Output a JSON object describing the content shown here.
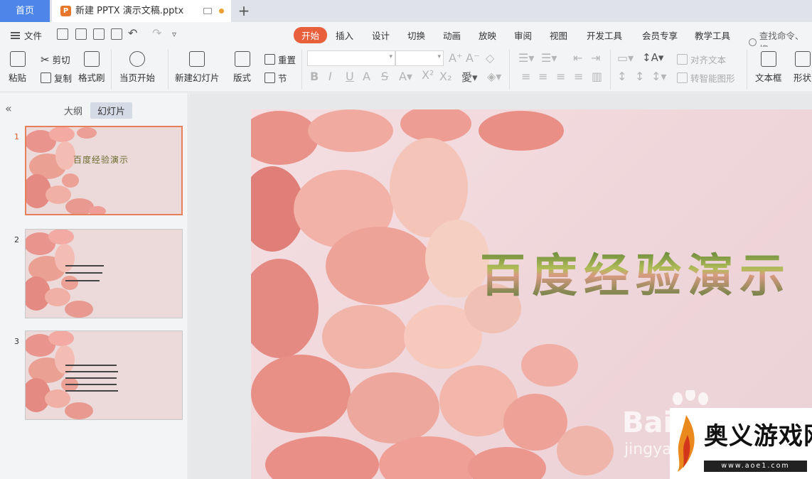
{
  "tabs": {
    "home": "首页",
    "doc_badge": "P",
    "doc_title": "新建 PPTX 演示文稿.pptx",
    "add": "+"
  },
  "menu": {
    "file": "文件",
    "tabs": [
      "开始",
      "插入",
      "设计",
      "切换",
      "动画",
      "放映",
      "审阅",
      "视图",
      "开发工具",
      "会员专享",
      "教学工具"
    ],
    "search": "查找命令、搜"
  },
  "ribbon": {
    "paste": "粘贴",
    "cut": "剪切",
    "copy": "复制",
    "format_painter": "格式刷",
    "play_from_current": "当页开始",
    "new_slide": "新建幻灯片",
    "layout": "版式",
    "reset": "重置",
    "section": "节",
    "align_text": "对齐文本",
    "smart_art": "转智能图形",
    "text_box": "文本框",
    "shape": "形状"
  },
  "left_panel": {
    "outline_tab": "大纲",
    "slides_tab": "幻灯片",
    "slides": [
      {
        "number": "1",
        "title": "百度经验演示"
      },
      {
        "number": "2"
      },
      {
        "number": "3"
      }
    ]
  },
  "slide": {
    "title": "百度经验演示",
    "watermark_brand": "Bai",
    "watermark_sub": "jingya"
  },
  "corner_logo": {
    "brand": "奥义游戏网",
    "url": "www.aoe1.com"
  },
  "colors": {
    "accent": "#e85f3b",
    "home_tab": "#4d86e8",
    "title_green": "#3c6a2a"
  }
}
